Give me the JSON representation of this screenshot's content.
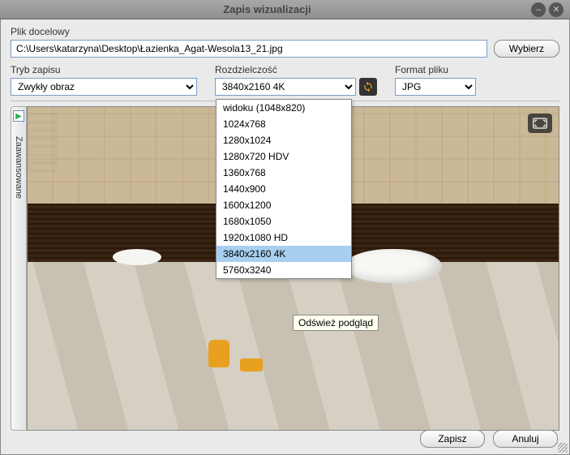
{
  "titlebar": {
    "title": "Zapis wizualizacji"
  },
  "file": {
    "label": "Plik docelowy",
    "path": "C:\\Users\\katarzyna\\Desktop\\Łazienka_Agat-Wesola13_21.jpg",
    "browse": "Wybierz"
  },
  "mode": {
    "label": "Tryb zapisu",
    "value": "Zwykły obraz"
  },
  "resolution": {
    "label": "Rozdzielczość",
    "value": "3840x2160 4K",
    "options": [
      "widoku (1048x820)",
      "1024x768",
      "1280x1024",
      "1280x720 HDV",
      "1360x768",
      "1440x900",
      "1600x1200",
      "1680x1050",
      "1920x1080 HD",
      "3840x2160 4K",
      "5760x3240"
    ],
    "selected_index": 9,
    "refresh_tooltip": "Odśwież podgląd"
  },
  "format": {
    "label": "Format pliku",
    "value": "JPG"
  },
  "side_tab": {
    "label": "Zaawansowane"
  },
  "buttons": {
    "save": "Zapisz",
    "cancel": "Anuluj"
  }
}
